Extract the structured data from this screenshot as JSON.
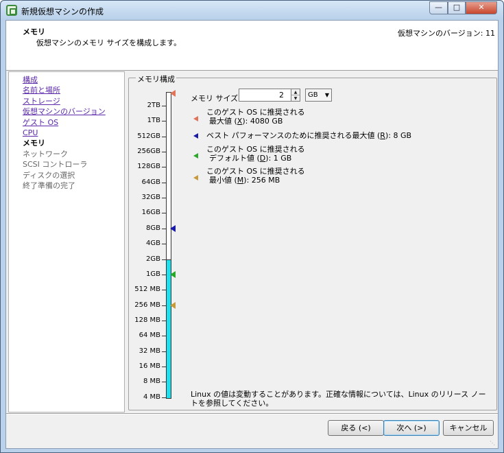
{
  "window": {
    "title": "新規仮想マシンの作成"
  },
  "header": {
    "title": "メモリ",
    "description": "仮想マシンのメモリ サイズを構成します。",
    "version": "仮想マシンのバージョン: 11"
  },
  "nav": {
    "items": [
      {
        "label": "構成",
        "state": "link"
      },
      {
        "label": "名前と場所",
        "state": "link"
      },
      {
        "label": "ストレージ",
        "state": "link"
      },
      {
        "label": "仮想マシンのバージョン",
        "state": "link"
      },
      {
        "label": "ゲスト OS",
        "state": "link"
      },
      {
        "label": "CPU",
        "state": "link"
      },
      {
        "label": "メモリ",
        "state": "current"
      },
      {
        "label": "ネットワーク",
        "state": "future"
      },
      {
        "label": "SCSI コントローラ",
        "state": "future"
      },
      {
        "label": "ディスクの選択",
        "state": "future"
      },
      {
        "label": "終了準備の完了",
        "state": "future"
      }
    ]
  },
  "memory": {
    "group_title": "メモリ構成",
    "size_label": "メモリ サイズ:",
    "size_value": "2",
    "unit": "GB",
    "scale_labels": [
      "2TB",
      "1TB",
      "512GB",
      "256GB",
      "128GB",
      "64GB",
      "32GB",
      "16GB",
      "8GB",
      "4GB",
      "2GB",
      "1GB",
      "512 MB",
      "256 MB",
      "128 MB",
      "64 MB",
      "32 MB",
      "16 MB",
      "8 MB",
      "4 MB"
    ],
    "legend": [
      {
        "line1": "このゲスト OS に推奨される",
        "line2_pre": "最大値 (",
        "key": "X",
        "line2_post": "): 4080 GB",
        "color": "#e0735a"
      },
      {
        "line1": "",
        "line2_pre": "ベスト パフォーマンスのために推奨される最大値 (",
        "key": "R",
        "line2_post": "): 8 GB",
        "color": "#1a1aa8"
      },
      {
        "line1": "このゲスト OS に推奨される",
        "line2_pre": "デフォルト値 (",
        "key": "D",
        "line2_post": "): 1 GB",
        "color": "#2aa82a"
      },
      {
        "line1": "このゲスト OS に推奨される",
        "line2_pre": "最小値 (",
        "key": "M",
        "line2_post": "): 256 MB",
        "color": "#c89a3c"
      }
    ],
    "note": "Linux の値は変動することがあります。正確な情報については、Linux のリリース ノートを参照してください。"
  },
  "footer": {
    "back": "戻る (<)",
    "next": "次へ (>)",
    "cancel": "キャンセル"
  }
}
